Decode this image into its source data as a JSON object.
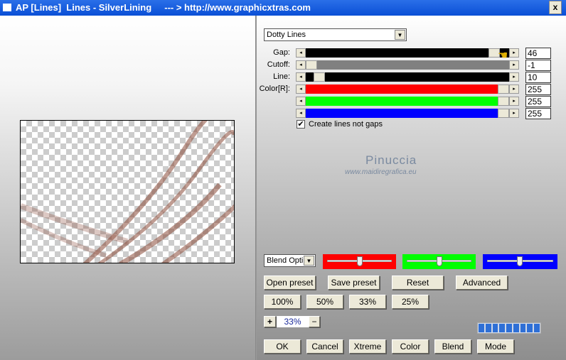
{
  "window": {
    "title": "AP [Lines]  Lines - SilverLining     --- > http://www.graphicxtras.com",
    "close": "x"
  },
  "preset_select": "Dotty Lines",
  "sliders": [
    {
      "label": "Gap:",
      "value": "46",
      "color": "#000000",
      "fraction": 0.95
    },
    {
      "label": "Cutoff:",
      "value": "-1",
      "color": "#808080",
      "fraction": 0.0
    },
    {
      "label": "Line:",
      "value": "10",
      "color": "#000000",
      "fraction": 0.04
    },
    {
      "label": "Color[R]:",
      "value": "255",
      "color": "#ff0000",
      "fraction": 1.0
    },
    {
      "label": "",
      "value": "255",
      "color": "#00ff00",
      "fraction": 1.0
    },
    {
      "label": "",
      "value": "255",
      "color": "#0000ff",
      "fraction": 1.0
    }
  ],
  "checkbox": {
    "label": "Create lines not gaps",
    "checked": true
  },
  "watermark": {
    "name": "Pinuccia",
    "url": "www.maidiregrafica.eu"
  },
  "blend_select": "Blend Opti",
  "buttons_row1": [
    "Open preset",
    "Save preset",
    "Reset",
    "Advanced"
  ],
  "zoom_buttons": [
    "100%",
    "50%",
    "33%",
    "25%"
  ],
  "zoom": {
    "plus": "+",
    "value": "33%",
    "minus": "−"
  },
  "buttons_bottom": [
    "OK",
    "Cancel",
    "Xtreme",
    "Color",
    "Blend",
    "Mode"
  ]
}
